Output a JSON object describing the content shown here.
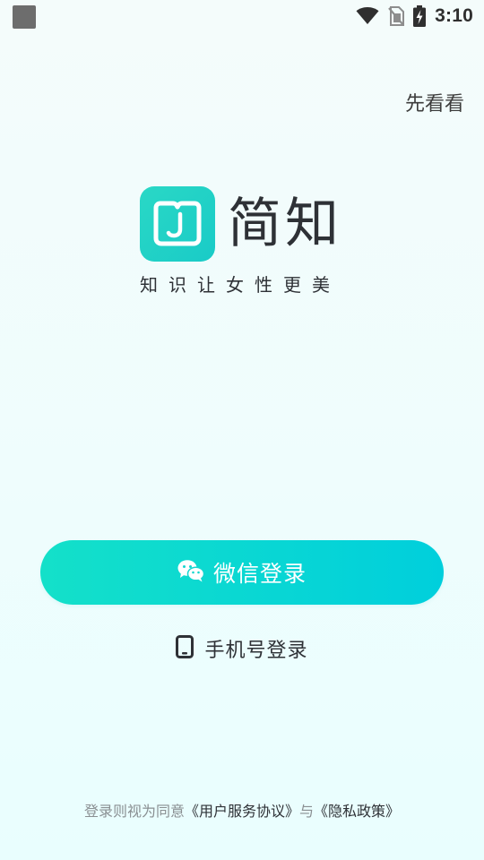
{
  "status_bar": {
    "time": "3:10",
    "icons": [
      "notification-square-icon",
      "wifi-icon",
      "no-sim-icon",
      "battery-charging-icon"
    ]
  },
  "header": {
    "skip_label": "先看看"
  },
  "brand": {
    "name": "简知",
    "slogan": "知识让女性更美",
    "logo_icon": "book-j-logo-icon",
    "accent_color": "#1dd3c4"
  },
  "actions": {
    "wechat_login_label": "微信登录",
    "wechat_icon": "wechat-icon",
    "phone_login_label": "手机号登录",
    "phone_icon": "phone-icon"
  },
  "agreement": {
    "prefix": "登录则视为同意",
    "user_agreement": "《用户服务协议》",
    "joiner": "与",
    "privacy_policy": "《隐私政策》"
  },
  "colors": {
    "button_gradient_start": "#14e0c9",
    "button_gradient_end": "#00cfdc",
    "text_dark": "#2e3136",
    "text_muted": "#8a8f92"
  }
}
